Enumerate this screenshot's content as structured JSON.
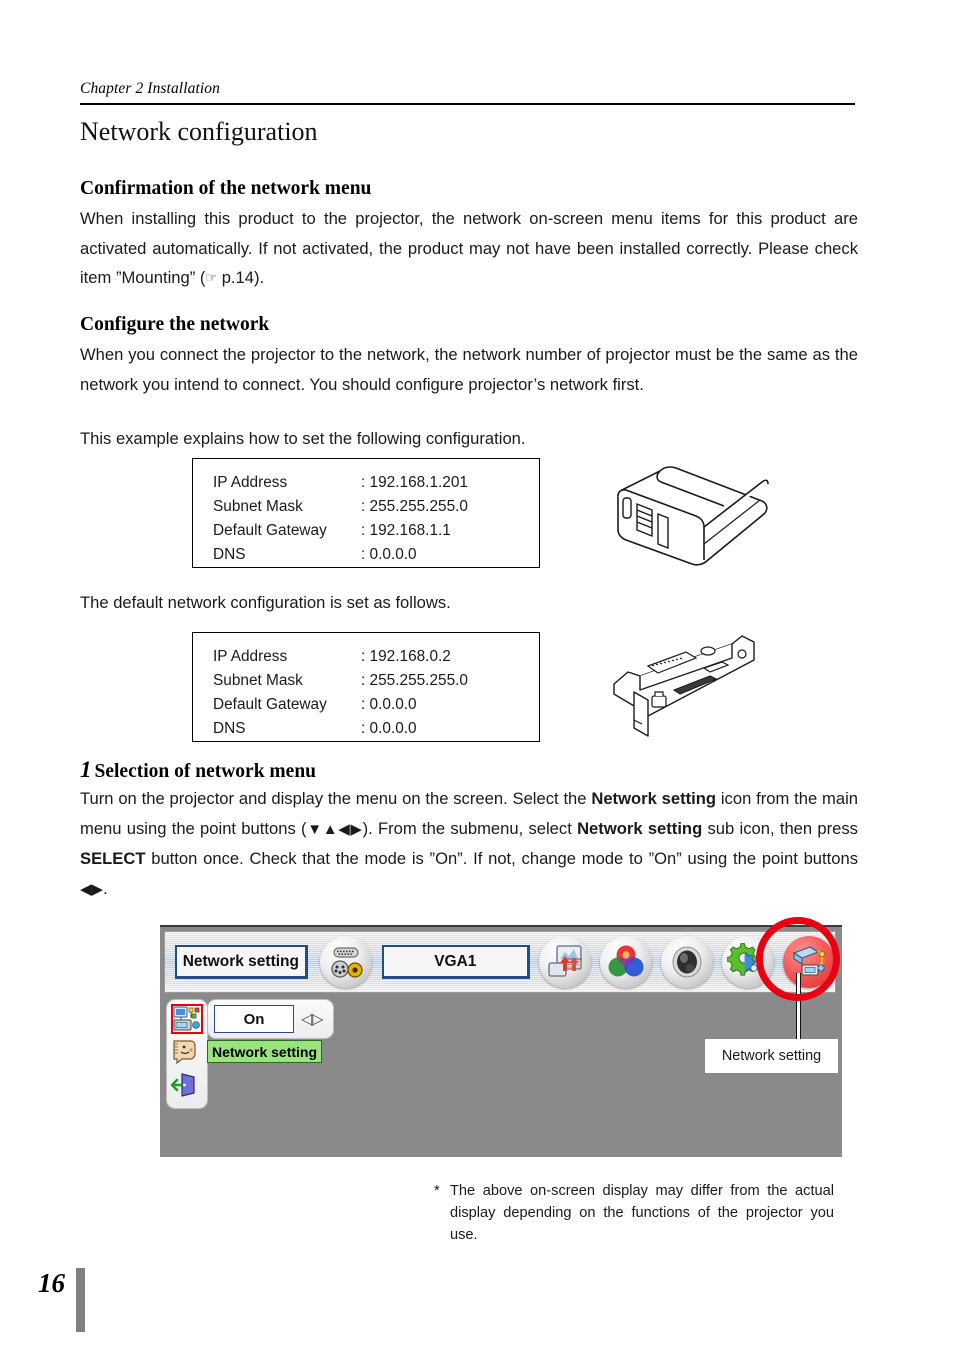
{
  "running_head": "Chapter 2 Installation",
  "page_title": "Network configuration",
  "sections": [
    {
      "heading": "Confirmation of the network menu",
      "paragraph_pre": "When installing this product to the projector, the network on-screen menu items for this product are activated automatically. If not activated, the product may not have been installed correctly. Please check item ”Mounting” (",
      "hand_icon": "☞",
      "paragraph_post": " p.14)."
    },
    {
      "heading": "Configure the network",
      "paragraph": "When you connect the projector to the network, the network number of projector must be the same as the network you intend to connect. You should configure projector’s network first.",
      "paragraph2": "This example explains how to set the following configuration."
    }
  ],
  "default_config_note": "The default network configuration is set as follows.",
  "config_tables": [
    {
      "name": "example-configuration",
      "rows": [
        {
          "key": "IP Address",
          "value": ": 192.168.1.201"
        },
        {
          "key": "Subnet Mask",
          "value": ": 255.255.255.0"
        },
        {
          "key": "Default Gateway",
          "value": ": 192.168.1.1"
        },
        {
          "key": "DNS",
          "value": ": 0.0.0.0"
        }
      ]
    },
    {
      "name": "default-configuration",
      "rows": [
        {
          "key": "IP Address",
          "value": ": 192.168.0.2"
        },
        {
          "key": "Subnet Mask",
          "value": ": 255.255.255.0"
        },
        {
          "key": "Default Gateway",
          "value": ": 0.0.0.0"
        },
        {
          "key": "DNS",
          "value": ": 0.0.0.0"
        }
      ]
    }
  ],
  "illustrations": [
    {
      "name": "projector-illustration",
      "alt": "projector"
    },
    {
      "name": "network-card-illustration",
      "alt": "network interface card"
    }
  ],
  "step": {
    "number": "1",
    "title": "Selection of network menu",
    "text_1": "Turn on the projector and display the menu on the screen. Select the ",
    "bold_1": "Network setting",
    "text_2": " icon from the main menu using the point buttons (",
    "arrows_1": "▼▲◀▶",
    "text_3": "). From the submenu, select ",
    "bold_2": "Network setting",
    "text_4": " sub icon, then press ",
    "bold_3": "SELECT",
    "text_5": " button once. Check that the mode is ”On”. If not, change mode to ”On” using the point buttons ",
    "arrows_2": "◀▶",
    "text_6": "."
  },
  "osd": {
    "menu_button_label": "Network setting",
    "input_label": "VGA1",
    "icons": [
      {
        "name": "input-source-icon",
        "label": "Input"
      },
      {
        "name": "pc-adjust-icon",
        "label": "PC adjust"
      },
      {
        "name": "color-adjust-icon",
        "label": "Color adjust"
      },
      {
        "name": "image-select-icon",
        "label": "Image select"
      },
      {
        "name": "setting-icon",
        "label": "Setting"
      },
      {
        "name": "network-setting-icon",
        "label": "Network setting"
      }
    ],
    "submenu": {
      "value": "On",
      "arrows": "◁▷",
      "tooltip": "Network setting",
      "items": [
        {
          "name": "network-setting-sub-icon",
          "selected": true
        },
        {
          "name": "information-icon",
          "selected": false
        },
        {
          "name": "quit-icon",
          "selected": false
        }
      ]
    },
    "callout_label": "Network setting",
    "highlight_color": "#e60012"
  },
  "footnote": {
    "marker": "*",
    "text": "The above on-screen display may differ from the actual display depending on the functions of the projector you use."
  },
  "page_number": "16"
}
